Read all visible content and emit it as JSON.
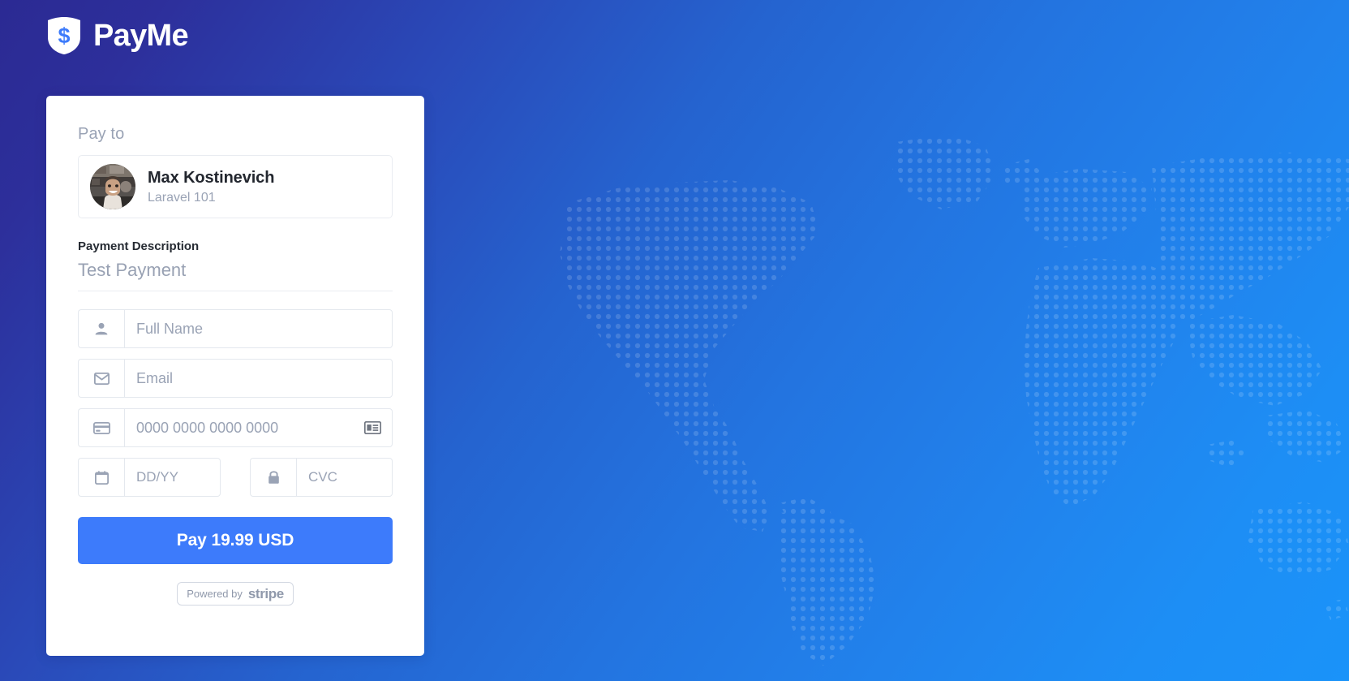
{
  "brand": {
    "name": "PayMe",
    "logo_icon": "dollar-shield-icon",
    "logo_symbol": "$"
  },
  "card": {
    "pay_to_label": "Pay to",
    "merchant": {
      "avatar_icon": "merchant-avatar-photo",
      "name": "Max Kostinevich",
      "subtitle": "Laravel 101"
    },
    "description": {
      "label": "Payment Description",
      "value": "Test Payment"
    },
    "fields": {
      "full_name": {
        "icon": "person-icon",
        "placeholder": "Full Name",
        "value": ""
      },
      "email": {
        "icon": "envelope-icon",
        "placeholder": "Email",
        "value": ""
      },
      "card_number": {
        "icon": "credit-card-icon",
        "placeholder": "0000 0000 0000 0000",
        "value": "",
        "trailing_icon": "card-type-id-icon"
      },
      "expiry": {
        "icon": "calendar-icon",
        "placeholder": "DD/YY",
        "value": ""
      },
      "cvc": {
        "icon": "lock-icon",
        "placeholder": "CVC",
        "value": ""
      }
    },
    "pay_button": {
      "label": "Pay 19.99 USD",
      "amount": "19.99",
      "currency": "USD"
    },
    "stripe_badge": {
      "powered_by": "Powered by",
      "provider": "stripe"
    }
  },
  "background": {
    "gradient_start": "#2b2a93",
    "gradient_end": "#1a93f9",
    "map_icon": "dotted-world-map",
    "dot_color": "#ffffff"
  },
  "theme": {
    "accent": "#3d7bfb",
    "card_bg": "#ffffff",
    "muted_text": "#9aa3b5",
    "border": "#e4e8ee"
  }
}
